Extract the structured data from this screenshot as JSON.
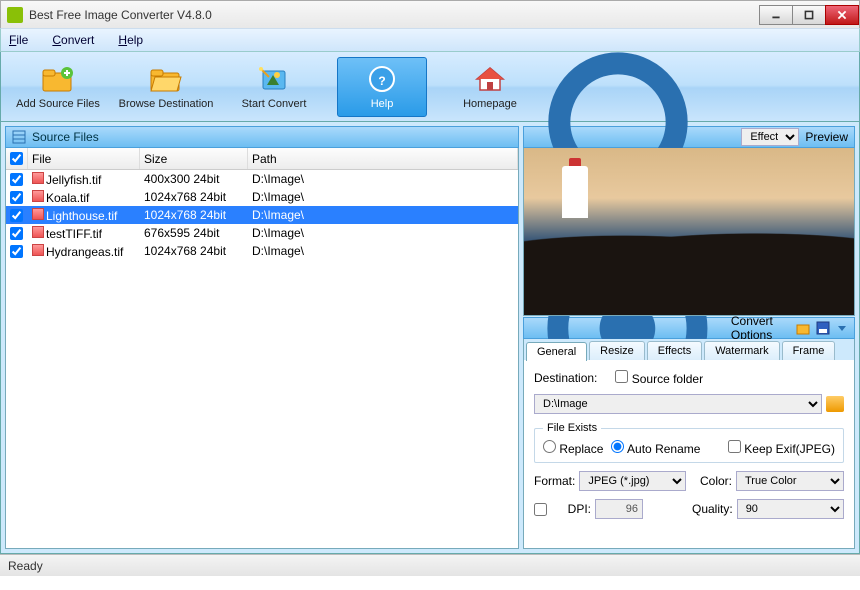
{
  "title": "Best Free Image Converter V4.8.0",
  "menu": {
    "file": "File",
    "convert": "Convert",
    "help": "Help"
  },
  "toolbar": {
    "add": "Add Source Files",
    "browse": "Browse Destination",
    "start": "Start Convert",
    "help": "Help",
    "home": "Homepage"
  },
  "sourceFiles": {
    "header": "Source Files",
    "cols": {
      "file": "File",
      "size": "Size",
      "path": "Path"
    }
  },
  "files": [
    {
      "name": "Jellyfish.tif",
      "size": "400x300  24bit",
      "path": "D:\\Image\\",
      "selected": false
    },
    {
      "name": "Koala.tif",
      "size": "1024x768  24bit",
      "path": "D:\\Image\\",
      "selected": false
    },
    {
      "name": "Lighthouse.tif",
      "size": "1024x768  24bit",
      "path": "D:\\Image\\",
      "selected": true
    },
    {
      "name": "testTIFF.tif",
      "size": "676x595  24bit",
      "path": "D:\\Image\\",
      "selected": false
    },
    {
      "name": "Hydrangeas.tif",
      "size": "1024x768  24bit",
      "path": "D:\\Image\\",
      "selected": false
    }
  ],
  "preview": {
    "effectLabel": "Effect",
    "label": "Preview"
  },
  "convert": {
    "header": "Convert Options",
    "tabs": {
      "general": "General",
      "resize": "Resize",
      "effects": "Effects",
      "watermark": "Watermark",
      "frame": "Frame"
    },
    "destLabel": "Destination:",
    "sourceFolder": "Source folder",
    "destPath": "D:\\Image",
    "fileExists": "File Exists",
    "replace": "Replace",
    "autoRename": "Auto Rename",
    "keepExif": "Keep Exif(JPEG)",
    "formatLabel": "Format:",
    "format": "JPEG (*.jpg)",
    "colorLabel": "Color:",
    "color": "True Color",
    "dpiLabel": "DPI:",
    "dpi": "96",
    "qualityLabel": "Quality:",
    "quality": "90"
  },
  "status": "Ready"
}
